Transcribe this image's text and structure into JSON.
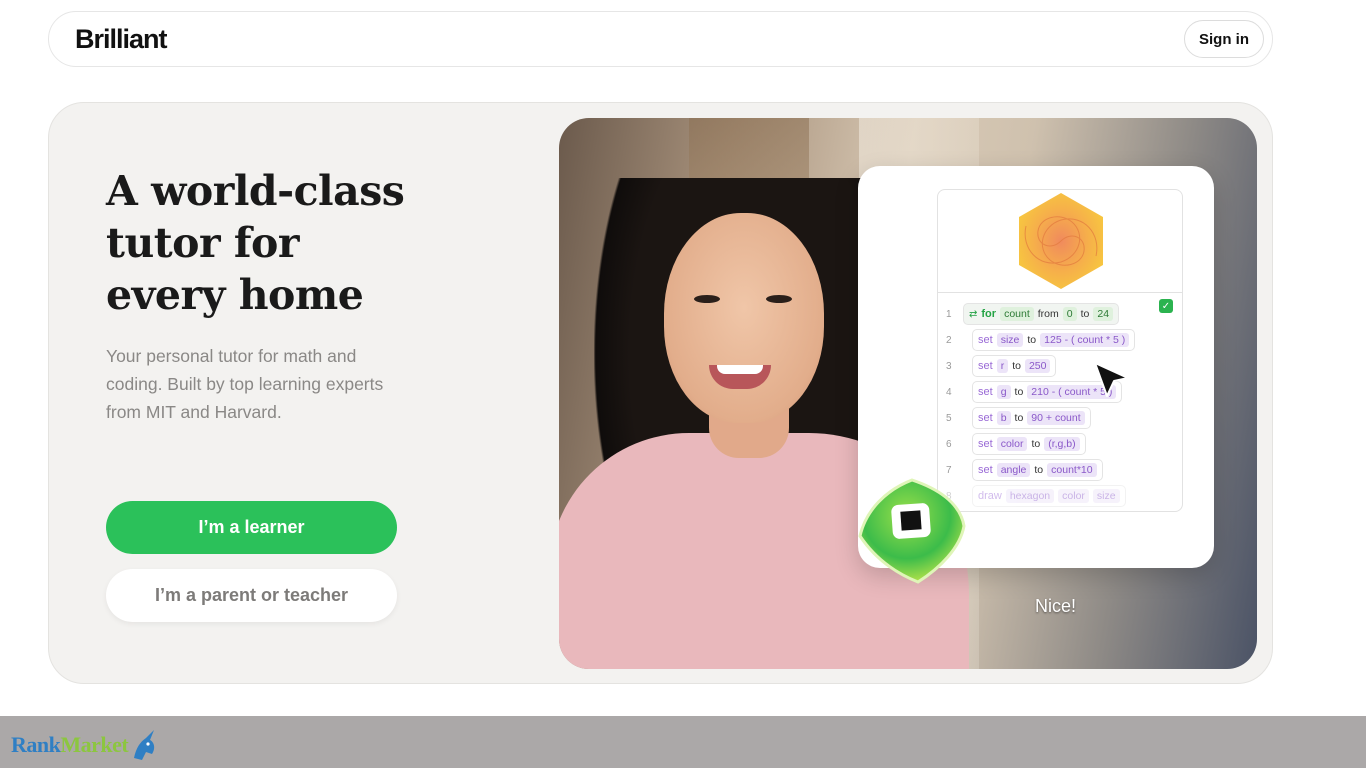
{
  "header": {
    "logo_text": "Brilliant",
    "signin_label": "Sign in"
  },
  "hero": {
    "headline": [
      "A world-class",
      "tutor for",
      "every home"
    ],
    "subtext": "Your personal tutor for math and coding. Built by top learning experts from MIT and Harvard.",
    "learner_button": "I’m a learner",
    "parent_button": "I’m a parent or teacher",
    "caption": "Nice!",
    "colors": {
      "primary_green": "#2bc15a",
      "hero_bg": "#f3f2f0"
    }
  },
  "code_panel": {
    "lines": [
      {
        "num": "1",
        "keyword": "for",
        "var": "count",
        "text1": "from",
        "a": "0",
        "text2": "to",
        "b": "24"
      },
      {
        "num": "2",
        "keyword": "set",
        "var": "size",
        "text1": "to",
        "expr": "125 - ( count * 5 )"
      },
      {
        "num": "3",
        "keyword": "set",
        "var": "r",
        "text1": "to",
        "expr": "250"
      },
      {
        "num": "4",
        "keyword": "set",
        "var": "g",
        "text1": "to",
        "expr": "210 - ( count * 5 )"
      },
      {
        "num": "5",
        "keyword": "set",
        "var": "b",
        "text1": "to",
        "expr": "90 + count"
      },
      {
        "num": "6",
        "keyword": "set",
        "var": "color",
        "text1": "to",
        "expr": "(r,g,b)"
      },
      {
        "num": "7",
        "keyword": "set",
        "var": "angle",
        "text1": "to",
        "expr": "count*10"
      },
      {
        "num": "8",
        "keyword": "draw",
        "var": "hexagon",
        "text1": "color",
        "expr": "size"
      }
    ],
    "icons": [
      "loop-icon",
      "checkbox-checked-icon",
      "cursor-arrow-icon",
      "hexagon-spiral-icon"
    ]
  },
  "watermark": {
    "part1": "Rank",
    "part2": "Market"
  }
}
